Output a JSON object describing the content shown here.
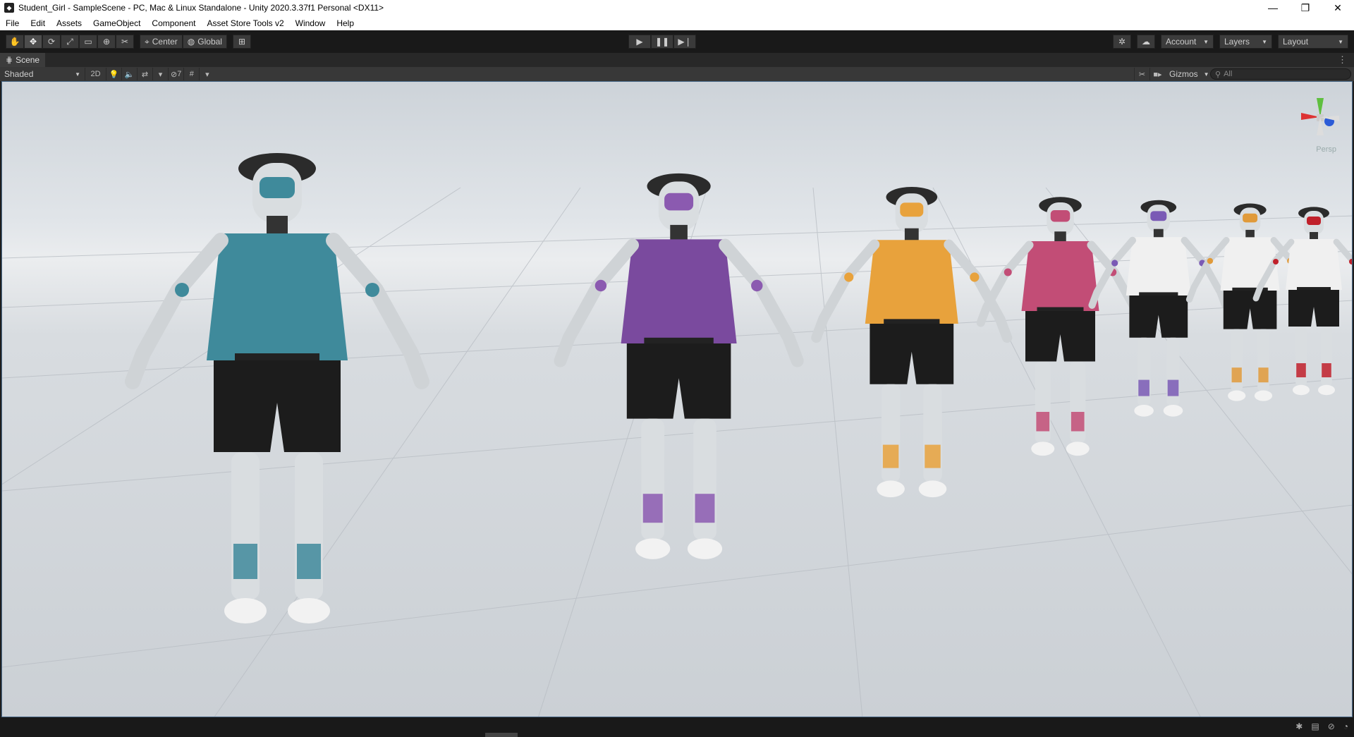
{
  "window": {
    "title": "Student_Girl - SampleScene - PC, Mac & Linux Standalone - Unity 2020.3.37f1 Personal <DX11>"
  },
  "menu": [
    "File",
    "Edit",
    "Assets",
    "GameObject",
    "Component",
    "Asset Store Tools v2",
    "Window",
    "Help"
  ],
  "toolbar": {
    "pivot_label": "Center",
    "space_label": "Global",
    "account_label": "Account",
    "layers_label": "Layers",
    "layout_label": "Layout"
  },
  "scene_tab": {
    "label": "Scene"
  },
  "scene_toolbar": {
    "draw_mode": "Shaded",
    "mode_2d": "2D",
    "hidden_count": "7",
    "gizmos_label": "Gizmos",
    "search_placeholder": "All"
  },
  "viewport": {
    "projection_label": "Persp"
  },
  "characters": [
    {
      "shirt": "#3f8a9b",
      "accent": "#3f8a9b"
    },
    {
      "shirt": "#7a4a9e",
      "accent": "#8b5ab0"
    },
    {
      "shirt": "#e8a23c",
      "accent": "#e8a23c"
    },
    {
      "shirt": "#c24d76",
      "accent": "#c24d76"
    },
    {
      "shirt": "#f0f0f0",
      "accent": "#7a5ab5"
    },
    {
      "shirt": "#f0f0f0",
      "accent": "#e09a3a"
    },
    {
      "shirt": "#f0f0f0",
      "accent": "#c0202a"
    }
  ]
}
